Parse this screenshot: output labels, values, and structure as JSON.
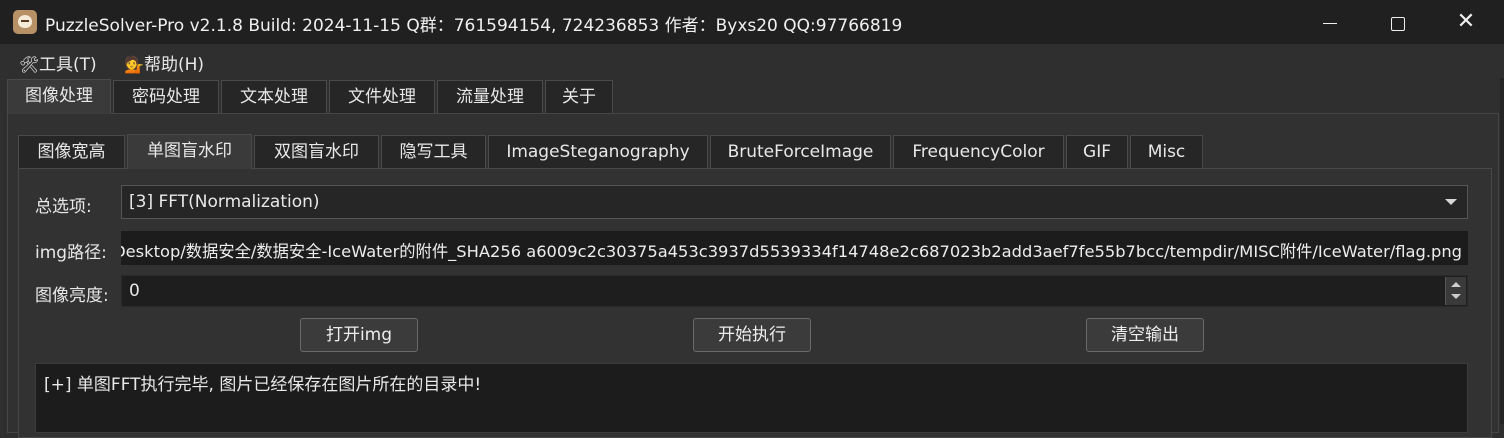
{
  "window": {
    "title": "PuzzleSolver-Pro v2.1.8  Build: 2024-11-15  Q群：761594154, 724236853  作者：Byxs20  QQ:97766819",
    "minimize": "—",
    "maximize": "☐",
    "close": "✕"
  },
  "menubar": {
    "tools": {
      "icon": "tools-icon",
      "label": "工具(T)"
    },
    "help": {
      "icon": "help-person-icon",
      "label": "帮助(H)"
    }
  },
  "main_tabs": [
    {
      "label": "图像处理",
      "active": true
    },
    {
      "label": "密码处理"
    },
    {
      "label": "文本处理"
    },
    {
      "label": "文件处理"
    },
    {
      "label": "流量处理"
    },
    {
      "label": "关于"
    }
  ],
  "sub_tabs": [
    {
      "label": "图像宽高"
    },
    {
      "label": "单图盲水印",
      "active": true
    },
    {
      "label": "双图盲水印"
    },
    {
      "label": "隐写工具"
    },
    {
      "label": "ImageSteganography"
    },
    {
      "label": "BruteForceImage"
    },
    {
      "label": "FrequencyColor"
    },
    {
      "label": "GIF"
    },
    {
      "label": "Misc"
    }
  ],
  "form": {
    "option_label": "总选项:",
    "option_value": "[3] FFT(Normalization)",
    "img_path_label": "img路径:",
    "img_path_value": "C:/Users/user/Desktop/数据安全/数据安全-IceWater的附件_SHA256 a6009c2c30375a453c3937d5539334f14748e2c687023b2add3aef7fe55b7bcc/tempdir/MISC附件/IceWater/flag.png",
    "brightness_label": "图像亮度:",
    "brightness_value": "0"
  },
  "buttons": {
    "open": "打开img",
    "run": "开始执行",
    "clear": "清空输出"
  },
  "output": {
    "text": "[+] 单图FFT执行完毕, 图片已经保存在图片所在的目录中!"
  },
  "colors": {
    "background": "#2f2f2f",
    "titlebar": "#202020",
    "field": "#1c1c1c"
  }
}
